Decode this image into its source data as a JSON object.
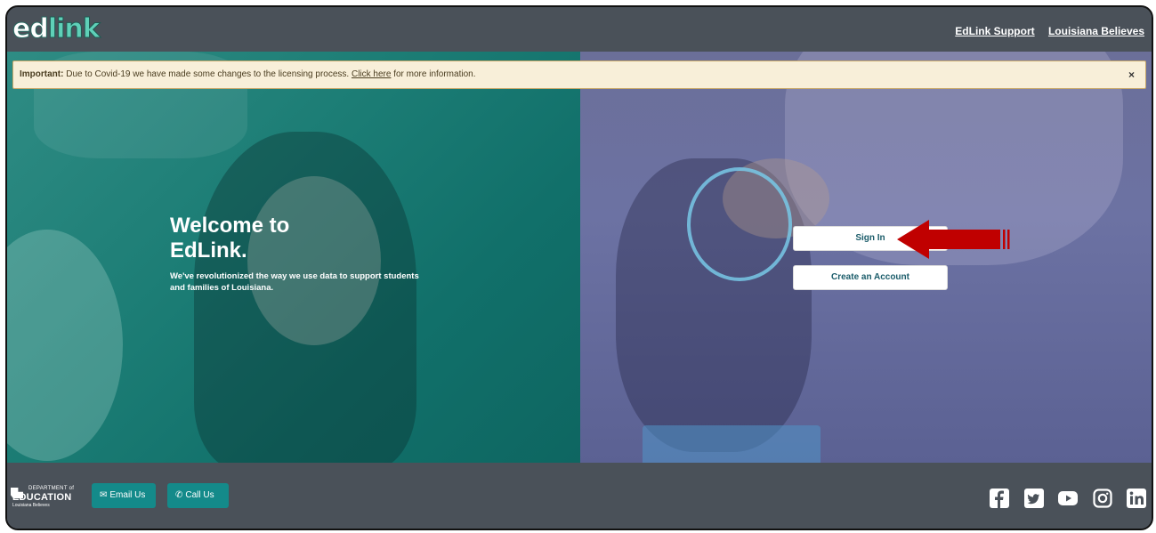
{
  "header": {
    "logo_text_ed": "ed",
    "logo_text_link": "link",
    "links": [
      "EdLink Support",
      "Louisiana Believes"
    ]
  },
  "alert": {
    "strong": "Important:",
    "text_before": " Due to Covid-19 we have made some changes to the licensing process. ",
    "link": "Click here",
    "text_after": " for more information.",
    "close": "×"
  },
  "hero": {
    "title": "Welcome to EdLink.",
    "subtitle": "We've revolutionized the way we use data to support students and families of Louisiana."
  },
  "actions": {
    "sign_in": "Sign In",
    "create_account": "Create an Account"
  },
  "footer": {
    "doe_dept": "DEPARTMENT of",
    "doe_edu": "EDUCATION",
    "doe_tagline": "Louisiana Believes",
    "email": "Email Us",
    "call": "Call Us",
    "social_icons": [
      "facebook-icon",
      "twitter-icon",
      "youtube-icon",
      "instagram-icon",
      "linkedin-icon"
    ]
  },
  "colors": {
    "header_bg": "#4a5159",
    "teal_overlay": "#1c7d75",
    "purple_overlay": "#6c72a3",
    "footer_button": "#148a8a",
    "alert_bg": "#f8efd9",
    "arrow": "#c00000"
  }
}
